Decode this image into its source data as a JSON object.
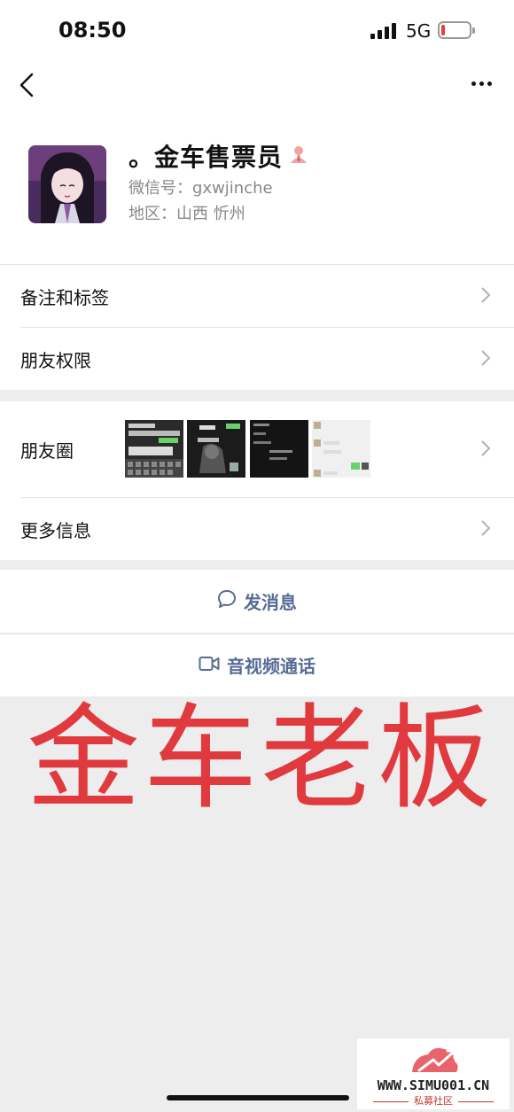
{
  "status_bar": {
    "time": "08:50",
    "network": "5G",
    "battery_level": 0.12
  },
  "navbar": {
    "back_icon": "chevron-left-icon",
    "more_icon": "ellipsis-icon"
  },
  "profile": {
    "nickname": "。金车售票员",
    "wechat_id": "微信号：gxwjinche",
    "region": "地区：山西 忻州",
    "badge_icon": "person-badge-icon"
  },
  "rows": {
    "remarks_tags": "备注和标签",
    "friend_permissions": "朋友权限",
    "moments": "朋友圈",
    "more_info": "更多信息"
  },
  "actions": {
    "send_message": "发消息",
    "video_call": "音视频通话",
    "accent_color": "#576b95"
  },
  "overlay_text": "金车老板",
  "watermark": {
    "site": "WWW.SIMU001.CN",
    "subtitle": "私募社区"
  }
}
